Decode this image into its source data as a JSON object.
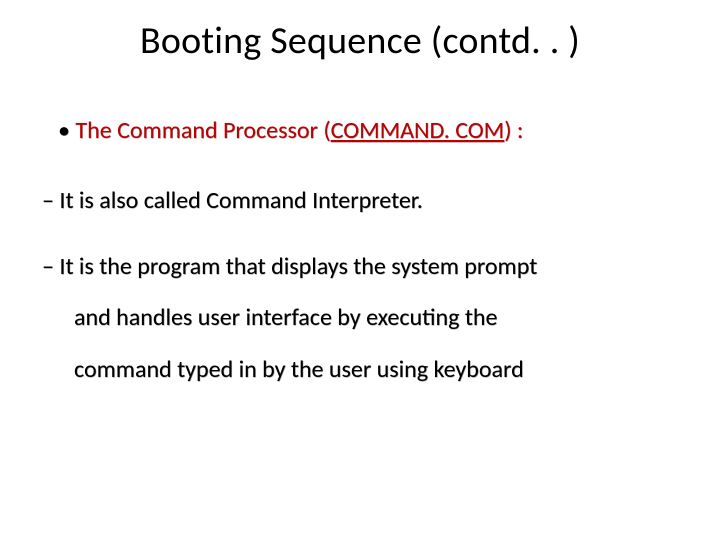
{
  "slide": {
    "title": "Booting Sequence (contd. . )",
    "bullet1_prefix": "The Command Processor (",
    "bullet1_command": "COMMAND. COM",
    "bullet1_suffix": ") :",
    "sub1": "It is also called Command Interpreter.",
    "sub2_line1": "It is the program that displays the system prompt",
    "sub2_line2": "and handles user interface by executing the",
    "sub2_line3": "command typed in by the user using keyboard"
  }
}
